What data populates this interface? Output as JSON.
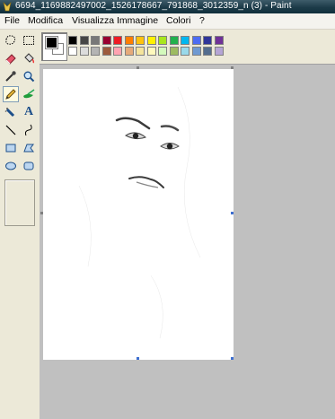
{
  "window": {
    "title": "6694_1169882497002_1526178667_791868_3012359_n (3) - Paint"
  },
  "menu": [
    "File",
    "Modifica",
    "Visualizza",
    "Immagine",
    "Colori",
    "?"
  ],
  "tools": [
    {
      "name": "free-select",
      "icon": "free-select-icon"
    },
    {
      "name": "rect-select",
      "icon": "rect-select-icon"
    },
    {
      "name": "eraser",
      "icon": "eraser-icon"
    },
    {
      "name": "fill",
      "icon": "fill-bucket-icon"
    },
    {
      "name": "pick-color",
      "icon": "eyedropper-icon"
    },
    {
      "name": "magnifier",
      "icon": "magnifier-icon"
    },
    {
      "name": "pencil",
      "icon": "pencil-icon",
      "active": true
    },
    {
      "name": "brush",
      "icon": "brush-icon"
    },
    {
      "name": "airbrush",
      "icon": "airbrush-icon"
    },
    {
      "name": "text",
      "icon": "text-icon",
      "label": "A"
    },
    {
      "name": "line",
      "icon": "line-icon"
    },
    {
      "name": "curve",
      "icon": "curve-icon"
    },
    {
      "name": "rectangle",
      "icon": "rectangle-icon"
    },
    {
      "name": "polygon",
      "icon": "polygon-icon"
    },
    {
      "name": "ellipse",
      "icon": "ellipse-icon"
    },
    {
      "name": "rounded-rectangle",
      "icon": "rounded-rectangle-icon"
    }
  ],
  "colors": {
    "foreground": "#000000",
    "background": "#ffffff",
    "palette_row1": [
      "#000000",
      "#464646",
      "#787878",
      "#980030",
      "#ed1c24",
      "#ff7e00",
      "#ffc20e",
      "#fff200",
      "#a8e61d",
      "#22b14c",
      "#00b7ef",
      "#4d6df3",
      "#2f3699",
      "#6f3198"
    ],
    "palette_row2": [
      "#ffffff",
      "#dcdcdc",
      "#b4b4b4",
      "#9c5a3c",
      "#ffa3b1",
      "#e5aa7a",
      "#f5e49c",
      "#fff9bd",
      "#d3f9bc",
      "#9dbb61",
      "#99d9ea",
      "#709ad1",
      "#546d8e",
      "#b5a5d5"
    ]
  }
}
